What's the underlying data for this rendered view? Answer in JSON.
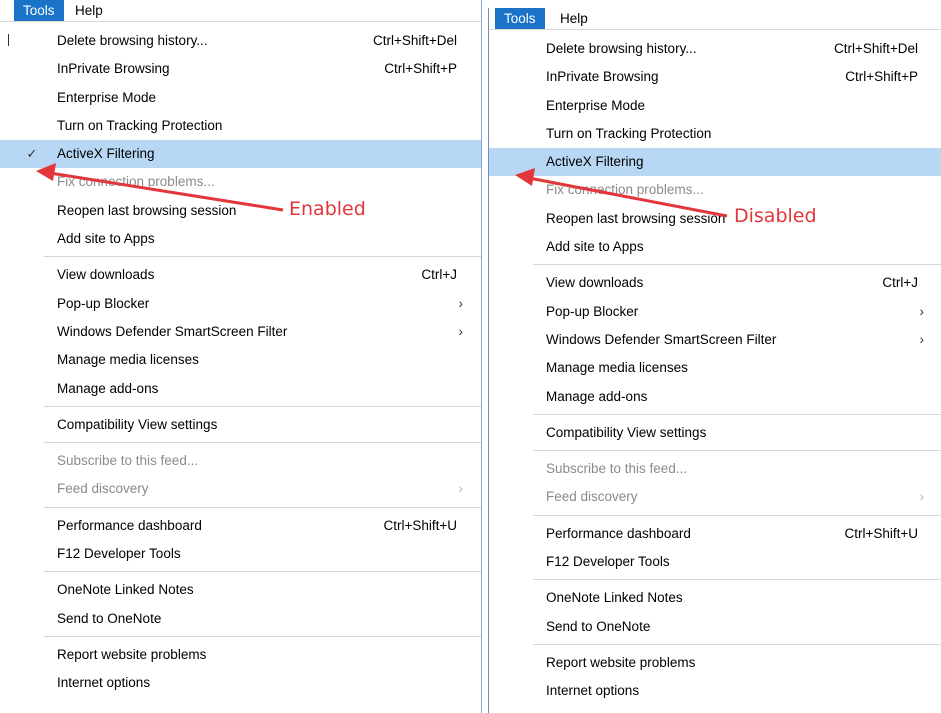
{
  "left": {
    "menubar": [
      "Tools",
      "Help"
    ],
    "annotation": "Enabled",
    "check_glyph": "✓"
  },
  "right": {
    "menubar": [
      "Tools",
      "Help"
    ],
    "annotation": "Disabled"
  },
  "menu": [
    {
      "label": "Delete browsing history...",
      "shortcut": "Ctrl+Shift+Del"
    },
    {
      "label": "InPrivate Browsing",
      "shortcut": "Ctrl+Shift+P"
    },
    {
      "label": "Enterprise Mode"
    },
    {
      "label": "Turn on Tracking Protection"
    },
    {
      "label": "ActiveX Filtering"
    },
    {
      "label": "Fix connection problems...",
      "disabled": true
    },
    {
      "label": "Reopen last browsing session"
    },
    {
      "label": "Add site to Apps"
    },
    {
      "sep": true
    },
    {
      "label": "View downloads",
      "shortcut": "Ctrl+J"
    },
    {
      "label": "Pop-up Blocker",
      "submenu": "›"
    },
    {
      "label": "Windows Defender SmartScreen Filter",
      "submenu": "›"
    },
    {
      "label": "Manage media licenses"
    },
    {
      "label": "Manage add-ons"
    },
    {
      "sep": true
    },
    {
      "label": "Compatibility View settings"
    },
    {
      "sep": true
    },
    {
      "label": "Subscribe to this feed...",
      "disabled": true
    },
    {
      "label": "Feed discovery",
      "disabled": true,
      "submenu": "›"
    },
    {
      "sep": true
    },
    {
      "label": "Performance dashboard",
      "shortcut": "Ctrl+Shift+U"
    },
    {
      "label": "F12 Developer Tools"
    },
    {
      "sep": true
    },
    {
      "label": "OneNote Linked Notes"
    },
    {
      "label": "Send to OneNote"
    },
    {
      "sep": true
    },
    {
      "label": "Report website problems"
    },
    {
      "label": "Internet options"
    }
  ],
  "colors": {
    "menubar_active": "#1a73c9",
    "highlight": "#b8d7f5",
    "annotation": "#e3363b"
  }
}
